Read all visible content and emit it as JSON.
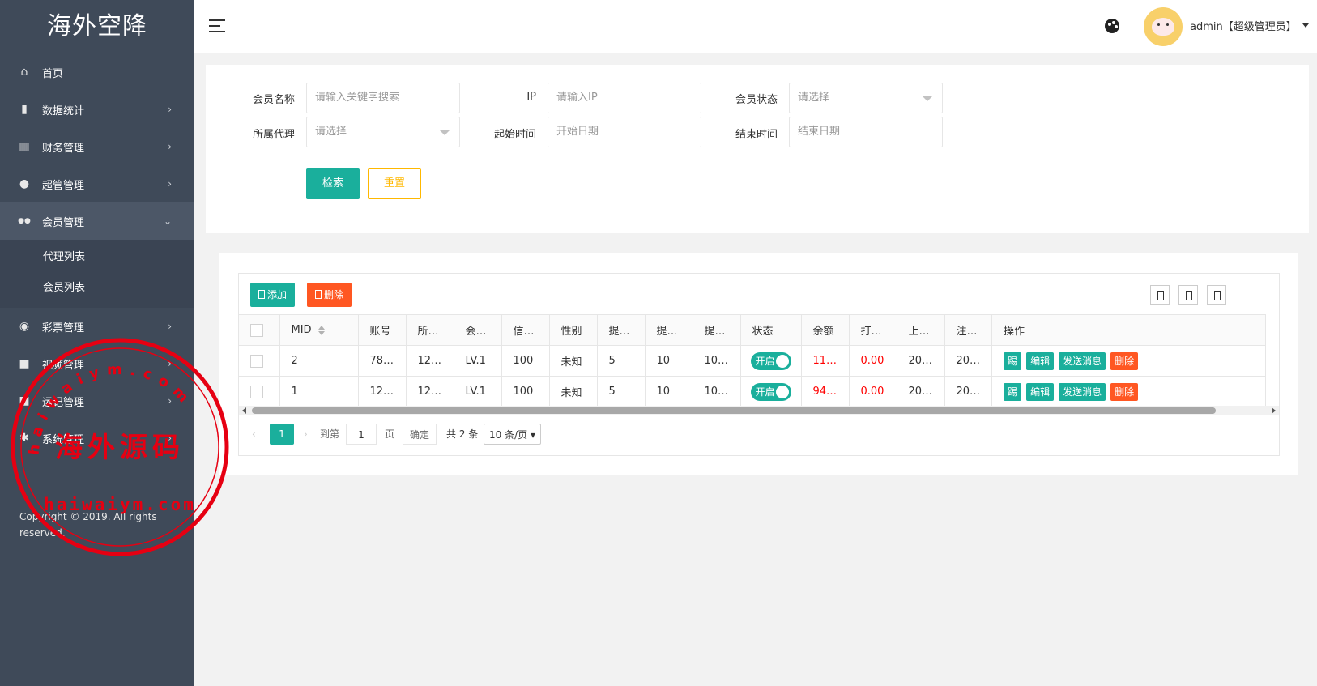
{
  "app": {
    "logo": "海外空降"
  },
  "sidebar": {
    "items": [
      {
        "label": "首页",
        "icon": "home-icon",
        "glyph": "⌂",
        "arrow": ""
      },
      {
        "label": "数据统计",
        "icon": "bar-chart-icon",
        "glyph": "▮",
        "arrow": "›"
      },
      {
        "label": "财务管理",
        "icon": "bank-icon",
        "glyph": "▥",
        "arrow": "›"
      },
      {
        "label": "超管管理",
        "icon": "user-icon",
        "glyph": "●",
        "arrow": "›"
      },
      {
        "label": "会员管理",
        "icon": "users-icon",
        "glyph": "●●",
        "arrow": "⌄"
      },
      {
        "label": "彩票管理",
        "icon": "gamepad-icon",
        "glyph": "◉",
        "arrow": "›"
      },
      {
        "label": "视频管理",
        "icon": "video-icon",
        "glyph": "■",
        "arrow": "›"
      },
      {
        "label": "运记管理",
        "icon": "log-icon",
        "glyph": "■",
        "arrow": "›"
      },
      {
        "label": "系统管理",
        "icon": "gear-icon",
        "glyph": "✱",
        "arrow": "›"
      }
    ],
    "sub_items": [
      "代理列表",
      "会员列表"
    ],
    "copyright_line1": "Copyright © 2019. All rights",
    "copyright_line2": "reserved."
  },
  "header": {
    "user": "admin【超级管理员】"
  },
  "search": {
    "member_name_label": "会员名称",
    "member_name_placeholder": "请输入关键字搜索",
    "ip_label": "IP",
    "ip_placeholder": "请输入IP",
    "status_label": "会员状态",
    "status_value": "请选择",
    "agent_label": "所属代理",
    "agent_value": "请选择",
    "start_label": "起始时间",
    "start_placeholder": "开始日期",
    "end_label": "结束时间",
    "end_placeholder": "结束日期",
    "search_btn": "检索",
    "reset_btn": "重置"
  },
  "toolbar": {
    "add": "添加",
    "delete": "删除"
  },
  "table": {
    "headers": [
      "MID",
      "账号",
      "所…",
      "会…",
      "信…",
      "性别",
      "提…",
      "提…",
      "提…",
      "状态",
      "余额",
      "打…",
      "上…",
      "注…",
      "操作"
    ],
    "rows": [
      {
        "mid": "2",
        "account": "78…",
        "agent": "12…",
        "level": "LV.1",
        "credit": "100",
        "gender": "未知",
        "w1": "5",
        "w2": "10",
        "w3": "10…",
        "status": "开启",
        "balance": "11…",
        "bet": "0.00",
        "last": "20…",
        "reg": "20…"
      },
      {
        "mid": "1",
        "account": "12…",
        "agent": "12…",
        "level": "LV.1",
        "credit": "100",
        "gender": "未知",
        "w1": "5",
        "w2": "10",
        "w3": "10…",
        "status": "开启",
        "balance": "94…",
        "bet": "0.00",
        "last": "20…",
        "reg": "20…"
      }
    ],
    "ops": {
      "kick": "踢",
      "edit": "编辑",
      "send": "发送消息",
      "delete": "删除"
    }
  },
  "pager": {
    "current": "1",
    "goto_label": "到第",
    "goto_value": "1",
    "page_label": "页",
    "confirm": "确定",
    "total": "共 2 条",
    "page_size": "10 条/页"
  },
  "colors": {
    "sidebar": "#3f4a59",
    "primary": "#1aaf9c",
    "danger": "#ff5722",
    "warning": "#ffb800",
    "stamp": "#e60012"
  },
  "watermark": {
    "text_cn": "海外源码",
    "text_en": "haiwaiym.com"
  }
}
